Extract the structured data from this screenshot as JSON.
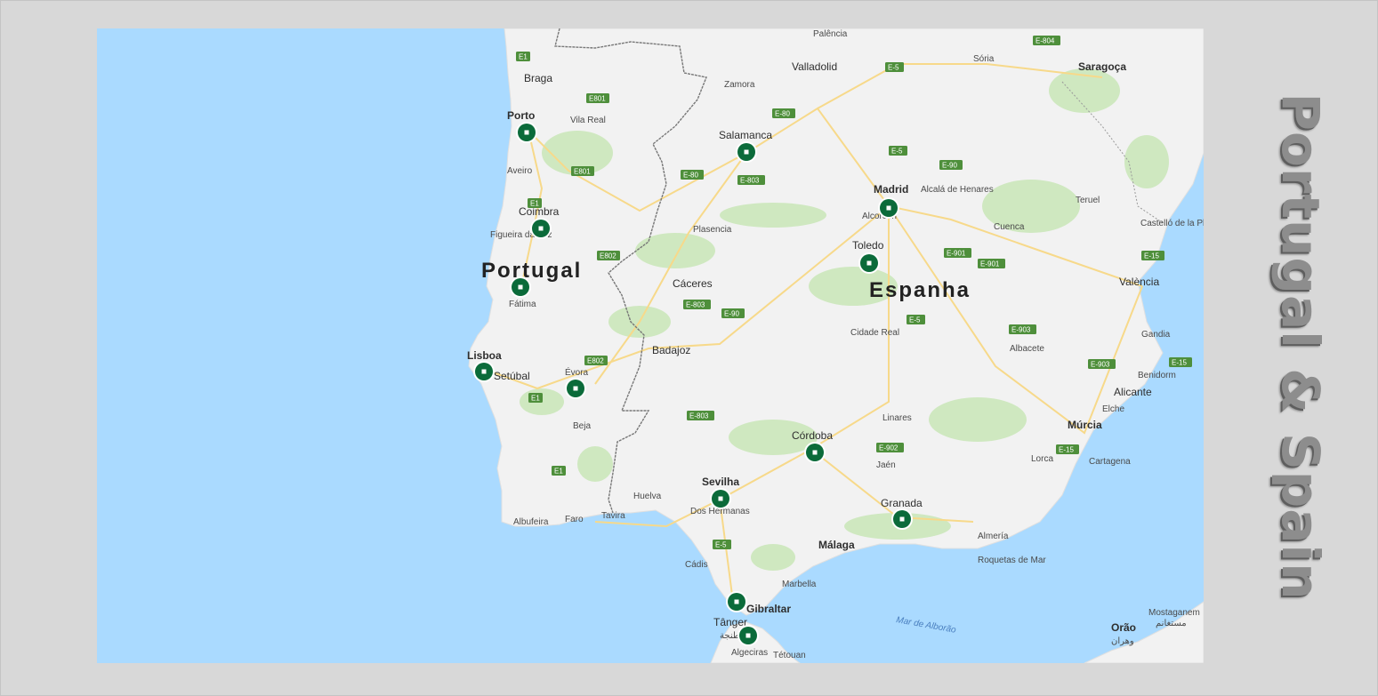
{
  "title": "Portugal & Spain",
  "map": {
    "countries": [
      {
        "name": "Portugal"
      },
      {
        "name": "Espanha"
      }
    ],
    "cities": [
      {
        "name": "Palência"
      },
      {
        "name": "Sória"
      },
      {
        "name": "Saragoça"
      },
      {
        "name": "Braga"
      },
      {
        "name": "Valladolid"
      },
      {
        "name": "Zamora"
      },
      {
        "name": "Porto"
      },
      {
        "name": "Vila Real"
      },
      {
        "name": "Salamanca"
      },
      {
        "name": "Aveiro"
      },
      {
        "name": "Madrid"
      },
      {
        "name": "Alcalá de Henares"
      },
      {
        "name": "Alcorcón"
      },
      {
        "name": "Teruel"
      },
      {
        "name": "Coimbra"
      },
      {
        "name": "Figueira da Foz"
      },
      {
        "name": "Plasencia"
      },
      {
        "name": "Cuenca"
      },
      {
        "name": "Castelló de la Plana"
      },
      {
        "name": "Toledo"
      },
      {
        "name": "Fátima"
      },
      {
        "name": "Cáceres"
      },
      {
        "name": "València"
      },
      {
        "name": "Cidade Real"
      },
      {
        "name": "Gandia"
      },
      {
        "name": "Badajoz"
      },
      {
        "name": "Albacete"
      },
      {
        "name": "Lisboa"
      },
      {
        "name": "Setúbal"
      },
      {
        "name": "Évora"
      },
      {
        "name": "Benidorm"
      },
      {
        "name": "Alicante"
      },
      {
        "name": "Elche"
      },
      {
        "name": "Linares"
      },
      {
        "name": "Múrcia"
      },
      {
        "name": "Beja"
      },
      {
        "name": "Córdoba"
      },
      {
        "name": "Jaén"
      },
      {
        "name": "Lorca"
      },
      {
        "name": "Cartagena"
      },
      {
        "name": "Sevilha"
      },
      {
        "name": "Huelva"
      },
      {
        "name": "Dos Hermanas"
      },
      {
        "name": "Granada"
      },
      {
        "name": "Faro"
      },
      {
        "name": "Tavira"
      },
      {
        "name": "Albufeira"
      },
      {
        "name": "Almería"
      },
      {
        "name": "Roquetas de Mar"
      },
      {
        "name": "Málaga"
      },
      {
        "name": "Cádis"
      },
      {
        "name": "Marbella"
      },
      {
        "name": "Gibraltar"
      },
      {
        "name": "Tânger"
      },
      {
        "name": "طنجة"
      },
      {
        "name": "Algeciras"
      },
      {
        "name": "Tétouan"
      },
      {
        "name": "Orão"
      },
      {
        "name": "وهران"
      },
      {
        "name": "Mostaganem"
      },
      {
        "name": "مستغانم"
      }
    ],
    "sea_labels": [
      "Mar de Alborão"
    ],
    "roads": [
      "E-804",
      "E-5",
      "E801",
      "E-80",
      "E1",
      "E801",
      "E-80",
      "E-803",
      "E-5",
      "E-90",
      "E1",
      "E802",
      "E-901",
      "E-901",
      "E-15",
      "E-803",
      "E-90",
      "E-5",
      "E-903",
      "E802",
      "E-903",
      "E-15",
      "E1",
      "E-803",
      "E-902",
      "E-15",
      "E1",
      "E-5"
    ],
    "markers": [
      {
        "label": "Porto"
      },
      {
        "label": "Salamanca"
      },
      {
        "label": "Madrid"
      },
      {
        "label": "Coimbra"
      },
      {
        "label": "Toledo"
      },
      {
        "label": "Fátima"
      },
      {
        "label": "Lisboa"
      },
      {
        "label": "Évora"
      },
      {
        "label": "Córdoba"
      },
      {
        "label": "Sevilha"
      },
      {
        "label": "Granada"
      },
      {
        "label": "Gibraltar"
      },
      {
        "label": "Tânger"
      }
    ],
    "colors": {
      "sea": "#aadaff",
      "land": "#f2f2f2",
      "vegetation": "#cfe8c0",
      "marker": "#0b6b3a",
      "road": "#f7d98a",
      "highway_badge": "#4e8f3b"
    }
  }
}
